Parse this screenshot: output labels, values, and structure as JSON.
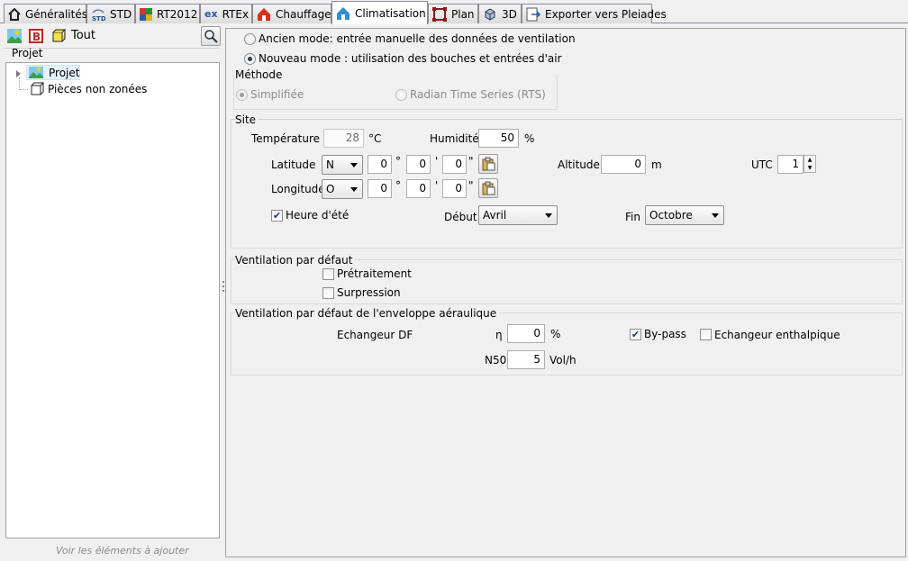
{
  "tabs": [
    {
      "label": "Généralités"
    },
    {
      "label": "STD"
    },
    {
      "label": "RT2012"
    },
    {
      "label": "RTEx"
    },
    {
      "label": "Chauffage"
    },
    {
      "label": "Climatisation"
    },
    {
      "label": "Plan"
    },
    {
      "label": "3D"
    },
    {
      "label": "Exporter vers Pleiades"
    }
  ],
  "left": {
    "toolbar_all": "Tout",
    "section_title": "Projet",
    "tree": [
      {
        "label": "Projet"
      },
      {
        "label": "Pièces non zonées"
      }
    ],
    "footer_hint": "Voir les éléments à ajouter"
  },
  "mode": {
    "old_mode": "Ancien mode: entrée manuelle des données de ventilation",
    "new_mode": "Nouveau mode : utilisation des bouches et entrées d'air",
    "method_title": "Méthode",
    "method_simple": "Simplifiée",
    "method_rts": "Radian Time Series (RTS)"
  },
  "site": {
    "title": "Site",
    "temperature_label": "Température",
    "temperature_value": "28",
    "temperature_unit": "°C",
    "humidity_label": "Humidité",
    "humidity_value": "50",
    "humidity_unit": "%",
    "latitude_label": "Latitude",
    "latitude_dir": "N",
    "latitude_deg": "0",
    "latitude_min": "0",
    "latitude_sec": "0",
    "longitude_label": "Longitude",
    "longitude_dir": "O",
    "longitude_deg": "0",
    "longitude_min": "0",
    "longitude_sec": "0",
    "deg_sym": "°",
    "min_sym": "'",
    "sec_sym": "\"",
    "altitude_label": "Altitude",
    "altitude_value": "0",
    "altitude_unit": "m",
    "utc_label": "UTC",
    "utc_value": "1",
    "summer_time_label": "Heure d'été",
    "start_label": "Début",
    "start_value": "Avril",
    "end_label": "Fin",
    "end_value": "Octobre"
  },
  "ventilation": {
    "title": "Ventilation par défaut",
    "pretreatment": "Prétraitement",
    "overpressure": "Surpression"
  },
  "envelope": {
    "title": "Ventilation par défaut de l'enveloppe aéraulique",
    "exchanger_label": "Echangeur DF",
    "eta_label": "η",
    "eta_value": "0",
    "eta_unit": "%",
    "bypass_label": "By-pass",
    "enthalpic_label": "Echangeur enthalpique",
    "n50_label": "N50",
    "n50_value": "5",
    "n50_unit": "Vol/h"
  }
}
